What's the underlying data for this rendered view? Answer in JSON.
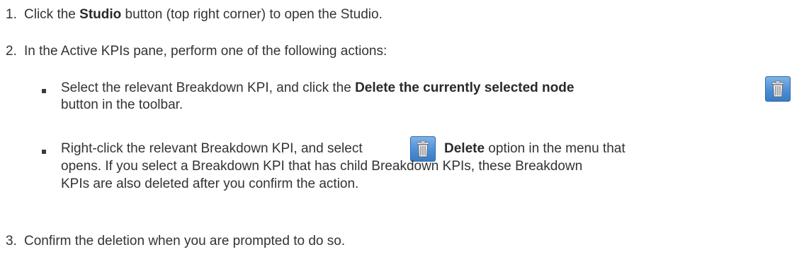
{
  "steps": [
    {
      "number": "1.",
      "pre": "Click the ",
      "bold": "Studio",
      "post": " button (top right corner) to open the Studio."
    },
    {
      "number": "2.",
      "text": "In the Active KPIs pane, perform one of the following actions:",
      "bullets": [
        {
          "pre": "Select the relevant Breakdown KPI, and click the ",
          "bold": "Delete the currently selected node",
          "line2": "button in the toolbar.",
          "icon": "trash-icon"
        },
        {
          "pre": "Right-click the relevant Breakdown KPI, and select ",
          "bold": "Delete",
          "post": " option in the menu that",
          "line2": "opens. If you select a Breakdown KPI that has child Breakdown KPIs, these Breakdown",
          "line3": "KPIs are also deleted after you confirm the action.",
          "icon": "trash-icon"
        }
      ]
    },
    {
      "number": "3.",
      "text": "Confirm the deletion when you are prompted to do so."
    }
  ]
}
